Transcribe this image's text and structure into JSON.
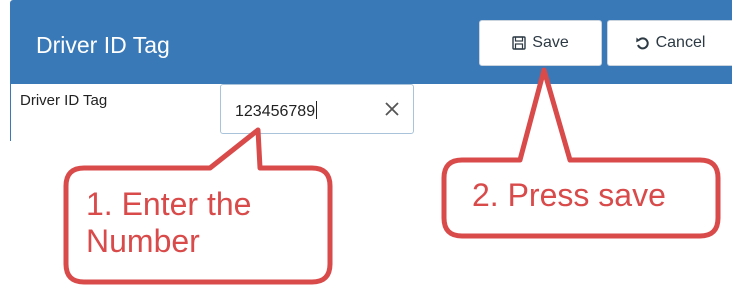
{
  "header": {
    "title": "Driver ID Tag"
  },
  "toolbar": {
    "save_label": "Save",
    "save_icon": "floppy-disk-icon",
    "cancel_label": "Cancel",
    "cancel_icon": "undo-icon"
  },
  "form": {
    "field_label": "Driver ID Tag",
    "field_value": "123456789",
    "clear_icon": "close-icon"
  },
  "annotations": {
    "step1_line1": "1. Enter the",
    "step1_line2": "Number",
    "step2": "2. Press save",
    "color": "#d94a4a"
  },
  "colors": {
    "header_bg": "#3a79b8",
    "callout_stroke": "#d94a4a"
  }
}
